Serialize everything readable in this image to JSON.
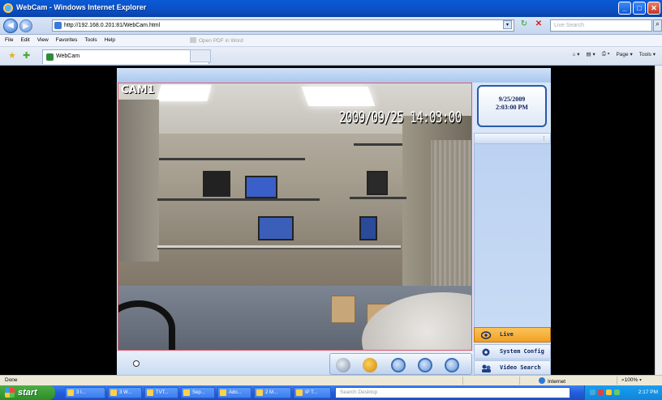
{
  "window": {
    "title": "WebCam - Windows Internet Explorer"
  },
  "window_buttons": {
    "minimize": "_",
    "maximize": "□",
    "close": "✕"
  },
  "address": {
    "url": "http://192.168.0.201:81/WebCam.html",
    "search_placeholder": "Live Search",
    "go_glyph": "▾",
    "refresh_glyph": "↻",
    "stop_glyph": "✕",
    "search_glyph": "⌕"
  },
  "menubar": {
    "items": [
      "File",
      "Edit",
      "View",
      "Favorites",
      "Tools",
      "Help"
    ],
    "open_pdf": "Open PDF in Word"
  },
  "tabs": {
    "active": "WebCam",
    "right_tools": [
      "Page",
      "Tools"
    ]
  },
  "webcam": {
    "camera_label": "CAM1",
    "osd_timestamp": "2009/09/25 14:03:00",
    "date": "9/25/2009",
    "time": "2:03:00 PM",
    "menu": [
      {
        "label": "Live",
        "active": true,
        "icon": "camera-icon"
      },
      {
        "label": "System Config",
        "active": false,
        "icon": "gear-icon"
      },
      {
        "label": "Video Search",
        "active": false,
        "icon": "search-people-icon"
      }
    ],
    "controls": [
      "snapshot-icon",
      "ptz-icon",
      "zoom-in-icon",
      "zoom-out-icon",
      "search-icon"
    ]
  },
  "status": {
    "text": "Done",
    "zone": "Internet",
    "zoom": "100%"
  },
  "taskbar": {
    "start": "start",
    "tasks": [
      "3 I...",
      "3 W...",
      "TVT...",
      "Sep...",
      "Ado...",
      "2 M...",
      "IP T..."
    ],
    "search_placeholder": "Search Desktop",
    "clock": "2:17 PM"
  },
  "colors": {
    "titlebar": "#0b4fc4",
    "video_border": "#e05a6a",
    "live_active": "#f2a024",
    "panel": "#c8dbf5"
  }
}
